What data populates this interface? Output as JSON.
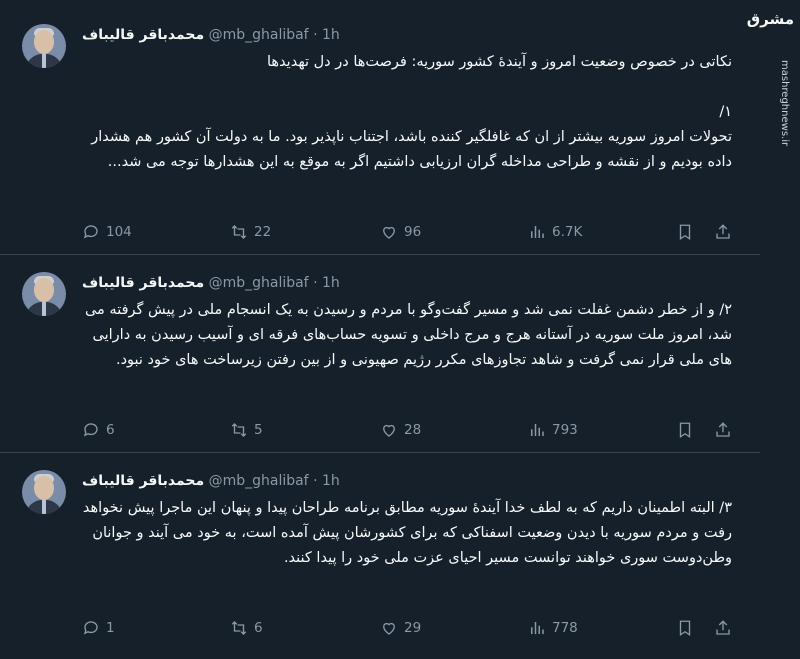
{
  "brand": {
    "logo_text": "مشرق",
    "site": "mashreghnews.ir"
  },
  "colors": {
    "background": "#15202b",
    "text": "#f7f9f9",
    "muted": "#8b98a5",
    "divider": "#38444d"
  },
  "tweets": [
    {
      "author": {
        "name": "محمدباقر قالیباف",
        "handle": "@mb_ghalibaf",
        "sep": "·",
        "time": "1h"
      },
      "text": "نکاتی در خصوص وضعیت امروز و آیندهٔ کشور سوریه: فرصت‌ها در دل تهدیدها\n\n۱/\nتحولات امروز سوریه بیشتر از ان که غافلگیر کننده باشد، اجتناب ناپذیر بود. ما به دولت آن کشور هم هشدار داده بودیم و از نقشه و طراحی مداخله گران ارزیابی داشتیم اگر به موقع به این هشدارها توجه می شد...",
      "stats": {
        "replies": "104",
        "reposts": "22",
        "likes": "96",
        "views": "6.7K"
      }
    },
    {
      "author": {
        "name": "محمدباقر قالیباف",
        "handle": "@mb_ghalibaf",
        "sep": "·",
        "time": "1h"
      },
      "text": "۲/ و از خطر دشمن غفلت نمی شد و مسیر گفت‌وگو با مردم و رسیدن به یک انسجام ملی در پیش گرفته می شد، امروز ملت سوریه در آستانه هرج و مرج داخلی و تسویه حساب‌های فرقه ای و آسیب رسیدن به دارایی های ملی قرار نمی گرفت و شاهد تجاوزهای مکرر رژیم صهیونی و از بین رفتن زیرساخت های خود نبود.",
      "stats": {
        "replies": "6",
        "reposts": "5",
        "likes": "28",
        "views": "793"
      }
    },
    {
      "author": {
        "name": "محمدباقر قالیباف",
        "handle": "@mb_ghalibaf",
        "sep": "·",
        "time": "1h"
      },
      "text": "۳/ البته اطمینان داریم که به لطف خدا آیندهٔ سوریه مطابق برنامه طراحان پیدا و پنهان این ماجرا پیش نخواهد رفت و مردم سوریه با دیدن وضعیت اسفناکی که برای کشورشان پیش آمده است، به خود می آیند و جوانان وطن‌دوست سوری خواهند توانست مسیر احیای عزت ملی خود را پیدا کنند.",
      "stats": {
        "replies": "1",
        "reposts": "6",
        "likes": "29",
        "views": "778"
      }
    }
  ]
}
